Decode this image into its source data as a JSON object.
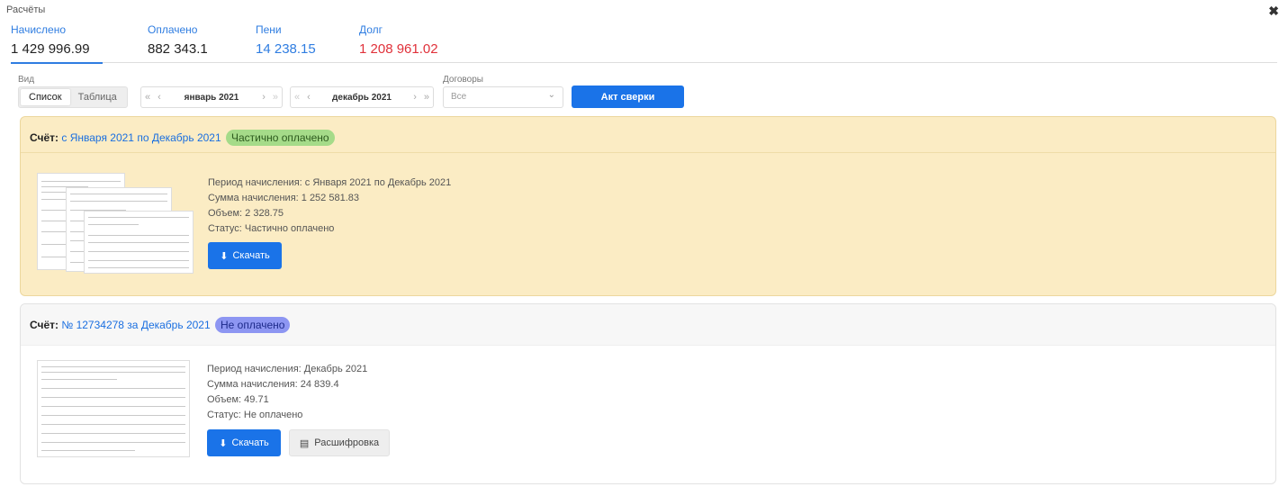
{
  "window": {
    "title": "Расчёты"
  },
  "totals": [
    {
      "label": "Начислено",
      "value": "1 429 996.99"
    },
    {
      "label": "Оплачено",
      "value": "882 343.1"
    },
    {
      "label": "Пени",
      "value": "14 238.15"
    },
    {
      "label": "Долг",
      "value": "1 208 961.02"
    }
  ],
  "filters": {
    "view_label": "Вид",
    "view_options": [
      "Список",
      "Таблица"
    ],
    "period_from": "январь 2021",
    "period_to": "декабрь 2021",
    "contracts_label": "Договоры",
    "contracts_value": "Все",
    "act_button": "Акт сверки"
  },
  "bills": [
    {
      "prefix": "Счёт:",
      "title": "с Января 2021 по Декабрь 2021",
      "status_badge": "Частично оплачено",
      "period": "Период начисления: с Января 2021 по Декабрь 2021",
      "amount": "Сумма начисления: 1 252 581.83",
      "volume": "Объем: 2 328.75",
      "status": "Статус: Частично оплачено",
      "download": "Скачать"
    },
    {
      "prefix": "Счёт:",
      "title": "№ 12734278 за Декабрь 2021",
      "status_badge": "Не оплачено",
      "period": "Период начисления: Декабрь 2021",
      "amount": "Сумма начисления: 24 839.4",
      "volume": "Объем: 49.71",
      "status": "Статус: Не оплачено",
      "download": "Скачать",
      "details": "Расшифровка"
    }
  ],
  "colors": {
    "accent": "#1a73e8",
    "debt": "#e0313a",
    "partial_card": "#fbecc4",
    "partial_badge": "#a5db89",
    "unpaid_badge": "#8d96f2"
  }
}
